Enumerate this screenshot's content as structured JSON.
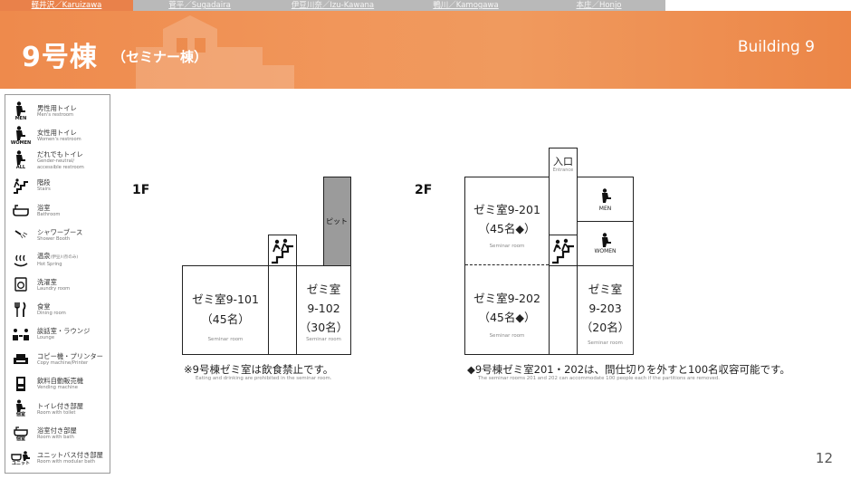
{
  "nav": {
    "tabs": [
      {
        "label": "軽井沢／Karuizawa",
        "active": true
      },
      {
        "label": "菅平／Sugadaira",
        "active": false
      },
      {
        "label": "伊豆川奈／Izu-Kawana",
        "active": false
      },
      {
        "label": "鴨川／Kamogawa",
        "active": false
      },
      {
        "label": "本庄／Honjo",
        "active": false
      }
    ]
  },
  "header": {
    "title": "9号棟",
    "subtitle": "（セミナー棟）",
    "building_label": "Building 9",
    "accent_color": "#ee8a4c"
  },
  "legend": {
    "items": [
      {
        "icon": "mens-restroom-icon",
        "tag": "MEN",
        "jp": "男性用トイレ",
        "en": "Men's restroom"
      },
      {
        "icon": "womens-restroom-icon",
        "tag": "WOMEN",
        "jp": "女性用トイレ",
        "en": "Women's restroom"
      },
      {
        "icon": "all-gender-restroom-icon",
        "tag": "ALL",
        "jp": "だれでもトイレ",
        "en": "Gender-neutral/",
        "en2": "accessible restroom"
      },
      {
        "icon": "stairs-icon",
        "tag": "",
        "jp": "階段",
        "en": "Stairs"
      },
      {
        "icon": "bathroom-icon",
        "tag": "",
        "jp": "浴室",
        "en": "Bathroom"
      },
      {
        "icon": "shower-icon",
        "tag": "",
        "jp": "シャワーブース",
        "en": "Shower Booth"
      },
      {
        "icon": "hot-spring-icon",
        "tag": "",
        "jp": "温泉",
        "jp_small": "(伊豆川奈のみ)",
        "en": "Hot Spring"
      },
      {
        "icon": "laundry-icon",
        "tag": "",
        "jp": "洗濯室",
        "en": "Laundry room"
      },
      {
        "icon": "dining-icon",
        "tag": "",
        "jp": "食堂",
        "en": "Dining room"
      },
      {
        "icon": "lounge-icon",
        "tag": "",
        "jp": "談話室・ラウンジ",
        "en": "Lounge"
      },
      {
        "icon": "copier-icon",
        "tag": "",
        "jp": "コピー機・プリンター",
        "en": "Copy machine/Printer"
      },
      {
        "icon": "vending-machine-icon",
        "tag": "",
        "jp": "飲料自動販売機",
        "en": "Vending machine"
      },
      {
        "icon": "room-with-toilet-icon",
        "tag": "個室",
        "jp": "トイレ付き部屋",
        "en": "Room with toilet"
      },
      {
        "icon": "room-with-bath-icon",
        "tag": "個室",
        "jp": "浴室付き部屋",
        "en": "Room with bath"
      },
      {
        "icon": "unit-bath-room-icon",
        "tag": "ユニット",
        "jp": "ユニットバス付き部屋",
        "en": "Room with modular bath"
      }
    ]
  },
  "floor1": {
    "label": "1F",
    "rooms": [
      {
        "id": "9-101",
        "line1": "ゼミ室9-101",
        "line2": "（45名）",
        "en": "Seminar room"
      },
      {
        "id": "9-102",
        "line1": "ゼミ室",
        "line2": "9-102",
        "line3": "（30名）",
        "en": "Seminar room"
      }
    ],
    "pit_label": "ピット",
    "note_jp": "※9号棟ゼミ室は飲食禁止です。",
    "note_en": "Eating and drinking are prohibited in the seminar room."
  },
  "floor2": {
    "label": "2F",
    "entrance_jp": "入口",
    "entrance_en": "Entrance",
    "men_label": "MEN",
    "women_label": "WOMEN",
    "rooms": [
      {
        "id": "9-201",
        "line1": "ゼミ室9-201",
        "line2": "（45名◆）",
        "en": "Seminar room"
      },
      {
        "id": "9-202",
        "line1": "ゼミ室9-202",
        "line2": "（45名◆）",
        "en": "Seminar room"
      },
      {
        "id": "9-203",
        "line1": "ゼミ室",
        "line2": "9-203",
        "line3": "（20名）",
        "en": "Seminar room"
      }
    ],
    "note_jp": "◆9号棟ゼミ室201・202は、間仕切りを外すと100名収容可能です。",
    "note_en": "The seminar rooms 201 and 202 can accommodate 100 people each if the partitions are removed."
  },
  "page_number": "12"
}
